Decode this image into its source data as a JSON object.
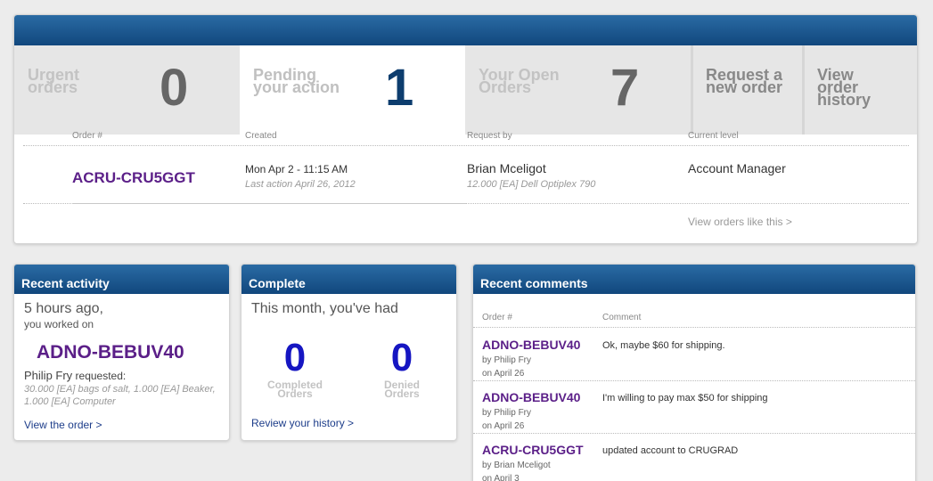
{
  "tabs": [
    {
      "label1": "Urgent",
      "label2": "orders",
      "label3": "",
      "count": "0"
    },
    {
      "label1": "Pending",
      "label2": "your action",
      "label3": "",
      "count": "1"
    },
    {
      "label1": "Your Open",
      "label2": "Orders",
      "label3": "",
      "count": "7"
    },
    {
      "label1": "Request a",
      "label2": "new order",
      "label3": ""
    },
    {
      "label1": "View",
      "label2": "order",
      "label3": "history"
    }
  ],
  "orders_table": {
    "headers": {
      "order": "Order #",
      "created": "Created",
      "request_by": "Request by",
      "level": "Current level"
    },
    "row": {
      "order": "ACRU-CRU5GGT",
      "created": "Mon Apr 2 - 11:15 AM",
      "last_action": "Last action April 26, 2012",
      "requester": "Brian Mceligot",
      "item": "12.000 [EA] Dell Optiplex 790",
      "level": "Account Manager"
    },
    "view_link": "View orders like this >"
  },
  "recent_activity": {
    "title": "Recent activity",
    "when": "5 hours ago,",
    "worked_on": "you worked on",
    "order": "ADNO-BEBUV40",
    "requester": "Philip Fry",
    "requested": " requested:",
    "items": "30.000 [EA] bags of salt, 1.000 [EA] Beaker, 1.000 [EA] Computer",
    "link": "View the order >"
  },
  "complete": {
    "title": "Complete",
    "intro": "This month, you've had",
    "completed_count": "0",
    "completed_label1": "Completed",
    "completed_label2": "Orders",
    "denied_count": "0",
    "denied_label1": "Denied",
    "denied_label2": "Orders",
    "link": "Review your history >"
  },
  "recent_comments": {
    "title": "Recent comments",
    "headers": {
      "order": "Order #",
      "comment": "Comment"
    },
    "items": [
      {
        "order": "ADNO-BEBUV40",
        "by": "by Philip Fry",
        "on": "on April 26",
        "comment": "Ok, maybe $60 for shipping."
      },
      {
        "order": "ADNO-BEBUV40",
        "by": "by Philip Fry",
        "on": "on April 26",
        "comment": "I'm willing to pay max $50 for shipping"
      },
      {
        "order": "ACRU-CRU5GGT",
        "by": "by Brian Mceligot",
        "on": "on April 3",
        "comment": "updated account to CRUGRAD"
      }
    ]
  },
  "colors": {
    "header_blue": "#11477d",
    "order_purple": "#5b1f88",
    "count_blue": "#1616c2",
    "active_count": "#0d3d6e"
  }
}
